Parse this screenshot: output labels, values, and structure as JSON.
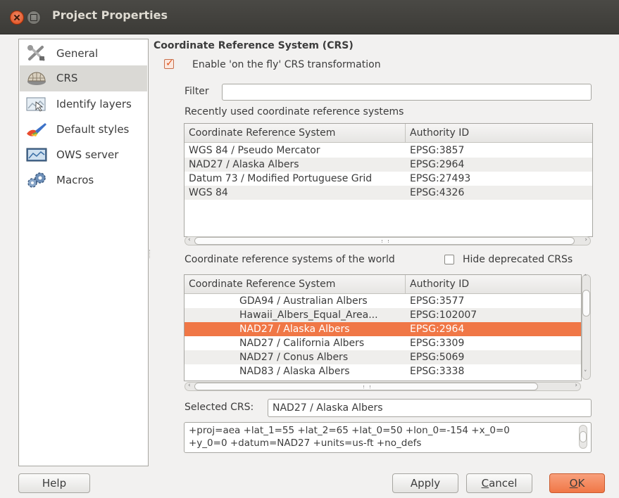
{
  "window": {
    "title": "Project Properties"
  },
  "colors": {
    "accent": "#f07746",
    "close_button": "#df4a16",
    "titlebar": "#3c3b37"
  },
  "sidebar": {
    "items": [
      {
        "label": "General",
        "icon": "tools-icon"
      },
      {
        "label": "CRS",
        "icon": "globe-icon",
        "selected": true
      },
      {
        "label": "Identify layers",
        "icon": "identify-icon"
      },
      {
        "label": "Default styles",
        "icon": "brush-icon"
      },
      {
        "label": "OWS server",
        "icon": "server-icon"
      },
      {
        "label": "Macros",
        "icon": "gears-icon"
      }
    ]
  },
  "crs": {
    "section_title": "Coordinate Reference System (CRS)",
    "otf_label": "Enable 'on the fly' CRS transformation",
    "otf_checked": true,
    "filter_label": "Filter",
    "filter_value": "",
    "recent_label": "Recently used coordinate reference systems",
    "recent_table": {
      "columns": [
        "Coordinate Reference System",
        "Authority ID"
      ],
      "rows": [
        [
          "WGS 84 / Pseudo Mercator",
          "EPSG:3857"
        ],
        [
          "NAD27 / Alaska Albers",
          "EPSG:2964"
        ],
        [
          "Datum 73 / Modified Portuguese Grid",
          "EPSG:27493"
        ],
        [
          "WGS 84",
          "EPSG:4326"
        ]
      ]
    },
    "world_label": "Coordinate reference systems of the world",
    "hide_deprecated_label": "Hide deprecated CRSs",
    "hide_deprecated_checked": false,
    "world_table": {
      "columns": [
        "Coordinate Reference System",
        "Authority ID"
      ],
      "rows": [
        [
          "GDA94 / Australian Albers",
          "EPSG:3577"
        ],
        [
          "Hawaii_Albers_Equal_Area...",
          "EPSG:102007"
        ],
        [
          "NAD27 / Alaska Albers",
          "EPSG:2964"
        ],
        [
          "NAD27 / California Albers",
          "EPSG:3309"
        ],
        [
          "NAD27 / Conus Albers",
          "EPSG:5069"
        ],
        [
          "NAD83 / Alaska Albers",
          "EPSG:3338"
        ]
      ],
      "selected_index": 2
    },
    "selected_label": "Selected CRS:",
    "selected_value": "NAD27 / Alaska Albers",
    "proj_line1": "+proj=aea +lat_1=55 +lat_2=65 +lat_0=50 +lon_0=-154 +x_0=0",
    "proj_line2": "+y_0=0 +datum=NAD27 +units=us-ft +no_defs"
  },
  "buttons": {
    "help": "Help",
    "apply": "Apply",
    "cancel_mnemonic": "C",
    "cancel_rest": "ancel",
    "ok_mnemonic": "O",
    "ok_rest": "K"
  }
}
